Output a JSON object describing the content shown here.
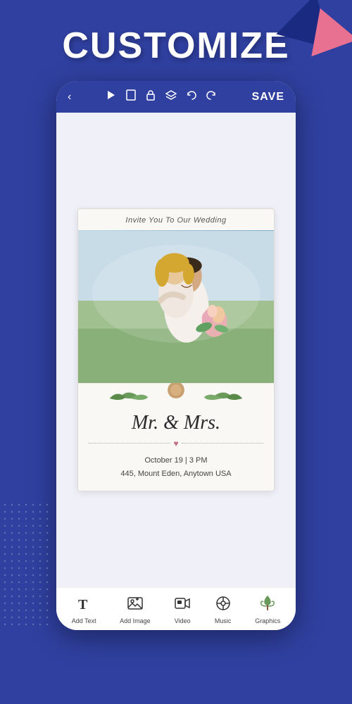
{
  "page": {
    "title": "CUSTOMIZE",
    "background_color": "#3040a0"
  },
  "toolbar": {
    "back_label": "‹",
    "save_label": "SAVE",
    "icons": [
      "▶",
      "▯",
      "🔓",
      "❖",
      "↩",
      "↪"
    ]
  },
  "wedding_card": {
    "top_text": "Invite You To Our Wedding",
    "couple_name": "Mr. & Mrs.",
    "date_line1": "October 19 | 3 PM",
    "date_line2": "445, Mount Eden, Anytown USA"
  },
  "bottom_tools": [
    {
      "id": "add-text",
      "label": "Add Text",
      "icon": "T"
    },
    {
      "id": "add-image",
      "label": "Add Image",
      "icon": "🖼"
    },
    {
      "id": "video",
      "label": "Video",
      "icon": "📹"
    },
    {
      "id": "music",
      "label": "Music",
      "icon": "🎵"
    },
    {
      "id": "graphics",
      "label": "Graphics",
      "icon": "🌿"
    }
  ],
  "decorations": {
    "triangle_colors": [
      "#1a2a80",
      "#e87090"
    ],
    "accent_color": "#c8a070"
  }
}
